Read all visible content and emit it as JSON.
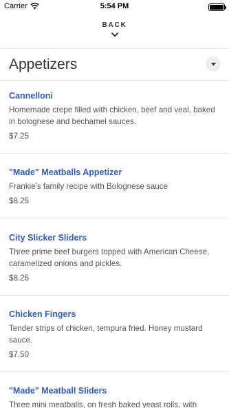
{
  "status_bar": {
    "carrier": "Carrier",
    "time": "5:54 PM"
  },
  "nav": {
    "back_label": "BACK"
  },
  "category": {
    "title": "Appetizers"
  },
  "menu_items": [
    {
      "name": "Cannelloni",
      "description": "Homemade crepe filled with chicken, beef and veal, baked in bolognese and bechamel sauces.",
      "price": "$7.25"
    },
    {
      "name": "\"Made\" Meatballs Appetizer",
      "description": "Frankie's family recipe with Bolognese sauce",
      "price": "$8.25"
    },
    {
      "name": "City Slicker Sliders",
      "description": "Three prime beef burgers topped with American Cheese, caramelized onions and pickles.",
      "price": "$8.25"
    },
    {
      "name": "Chicken Fingers",
      "description": "Tender strips of chicken, tempura fried. Honey mustard sauce.",
      "price": "$7.50"
    },
    {
      "name": "\"Made\" Meatball Sliders",
      "description": "Three mini meatballs, on fresh baked yeast rolls, with",
      "price": ""
    }
  ]
}
